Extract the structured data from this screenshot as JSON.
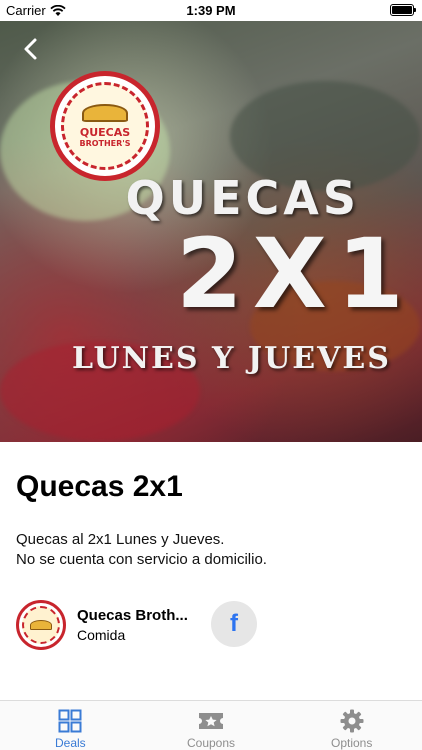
{
  "status_bar": {
    "carrier": "Carrier",
    "time": "1:39 PM"
  },
  "hero": {
    "logo_line1": "QUECAS",
    "logo_line2": "BROTHER'S",
    "title": "QUECAS",
    "big": "2X1",
    "subtitle": "LUNES Y JUEVES"
  },
  "deal": {
    "title": "Quecas 2x1",
    "description_line1": "Quecas al 2x1 Lunes y Jueves.",
    "description_line2": "No se cuenta con servicio a domicilio."
  },
  "merchant": {
    "name": "Quecas Broth...",
    "category": "Comida"
  },
  "facebook": {
    "label": "f"
  },
  "tabs": [
    {
      "label": "Deals",
      "icon": "grid-icon",
      "active": true
    },
    {
      "label": "Coupons",
      "icon": "ticket-star-icon",
      "active": false
    },
    {
      "label": "Options",
      "icon": "gear-icon",
      "active": false
    }
  ],
  "colors": {
    "accent": "#3a7bd5",
    "inactive": "#8e8e8e",
    "facebook": "#2d74f0",
    "logo_red": "#c8252d"
  }
}
